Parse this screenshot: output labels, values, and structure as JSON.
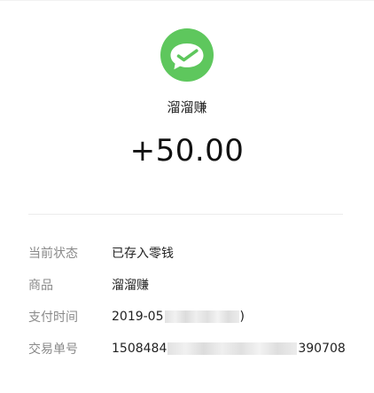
{
  "merchant": {
    "name": "溜溜赚",
    "logo_icon": "wechat-pay-icon",
    "logo_color": "#5ec75d"
  },
  "amount": "+50.00",
  "details": [
    {
      "label": "当前状态",
      "value": "已存入零钱"
    },
    {
      "label": "商品",
      "value": "溜溜赚"
    },
    {
      "label": "支付时间",
      "value_prefix": "2019-05",
      "value_suffix": ")"
    },
    {
      "label": "交易单号",
      "value_prefix": "1508484",
      "value_suffix": "390708"
    }
  ]
}
